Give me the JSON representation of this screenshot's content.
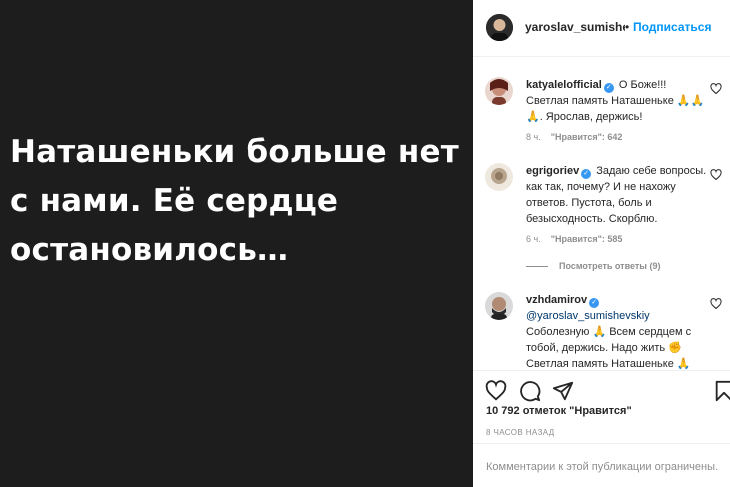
{
  "post": {
    "image_text": "Наташеньки больше нет с нами. Её сердце остановилось…"
  },
  "header": {
    "username": "yaroslav_sumishevskiy",
    "dot": "•",
    "follow_label": "Подписаться"
  },
  "comments": [
    {
      "username": "katyalelofficial",
      "verified": true,
      "text": "О Боже!!! Светлая память Наташеньке 🙏🙏🙏. Ярослав, держись!",
      "time": "8 ч.",
      "likes": "\"Нравится\": 642",
      "avatar_color": "#7a3b2e"
    },
    {
      "username": "egrigoriev",
      "verified": true,
      "text": "Задаю себе вопросы. как так, почему? И не нахожу ответов. Пустота, боль и безысходность. Скорблю.",
      "time": "6 ч.",
      "likes": "\"Нравится\": 585",
      "avatar_color": "#c9b9a6",
      "view_replies": "Посмотреть ответы (9)"
    },
    {
      "username": "vzhdamirov",
      "verified": true,
      "mention": "@yaroslav_sumishevskiy",
      "text": "Соболезную 🙏 Всем сердцем с тобой, держись. Надо жить ✊ Светлая память Наташеньке 🙏",
      "avatar_color": "#3a3a3a"
    }
  ],
  "actions": {
    "icons": [
      "heart-icon",
      "comment-icon",
      "share-icon",
      "bookmark-icon"
    ]
  },
  "likes_text": "10 792 отметок \"Нравится\"",
  "timestamp": "8 ЧАСОВ НАЗАД",
  "footer_text": "Комментарии к этой публикации ограничены."
}
